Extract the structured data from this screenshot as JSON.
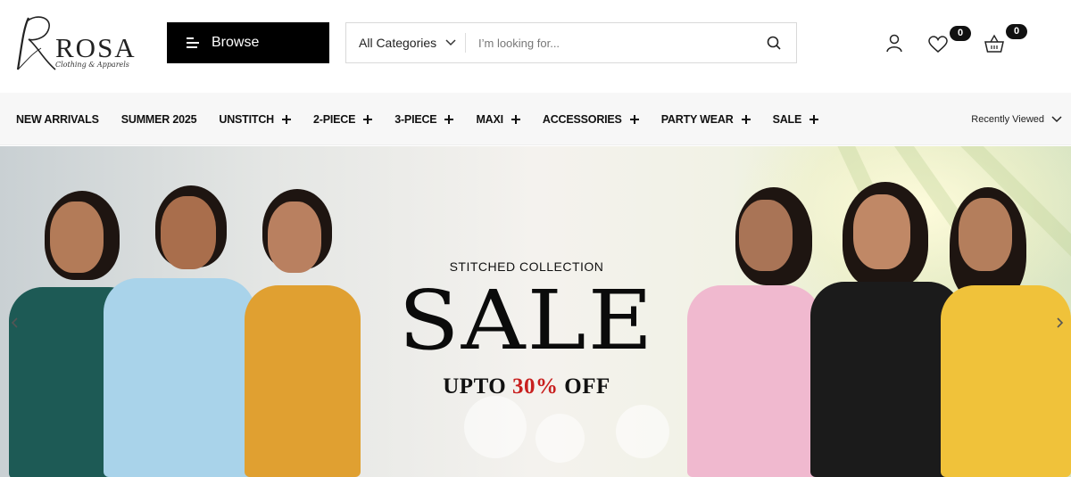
{
  "brand": {
    "name": "ROSA",
    "tagline": "Clothing & Apparels"
  },
  "browse": {
    "label": "Browse"
  },
  "search": {
    "category": "All Categories",
    "placeholder": "I’m looking for..."
  },
  "header_icons": {
    "wishlist_count": "0",
    "cart_count": "0"
  },
  "nav": {
    "items": [
      {
        "label": "NEW ARRIVALS",
        "expandable": false
      },
      {
        "label": "SUMMER 2025",
        "expandable": false
      },
      {
        "label": "UNSTITCH",
        "expandable": true
      },
      {
        "label": "2-PIECE",
        "expandable": true
      },
      {
        "label": "3-PIECE",
        "expandable": true
      },
      {
        "label": "MAXI",
        "expandable": true
      },
      {
        "label": "ACCESSORIES",
        "expandable": true
      },
      {
        "label": "PARTY WEAR",
        "expandable": true
      },
      {
        "label": "SALE",
        "expandable": true
      }
    ],
    "recently_viewed": "Recently Viewed"
  },
  "hero": {
    "subtitle": "STITCHED COLLECTION",
    "title": "SALE",
    "offer_prefix": "UPTO",
    "offer_percent": "30%",
    "offer_suffix": "OFF"
  },
  "colors": {
    "primary": "#000000",
    "nav_bg": "#f7f7f7",
    "sale_red": "#c8201f"
  }
}
